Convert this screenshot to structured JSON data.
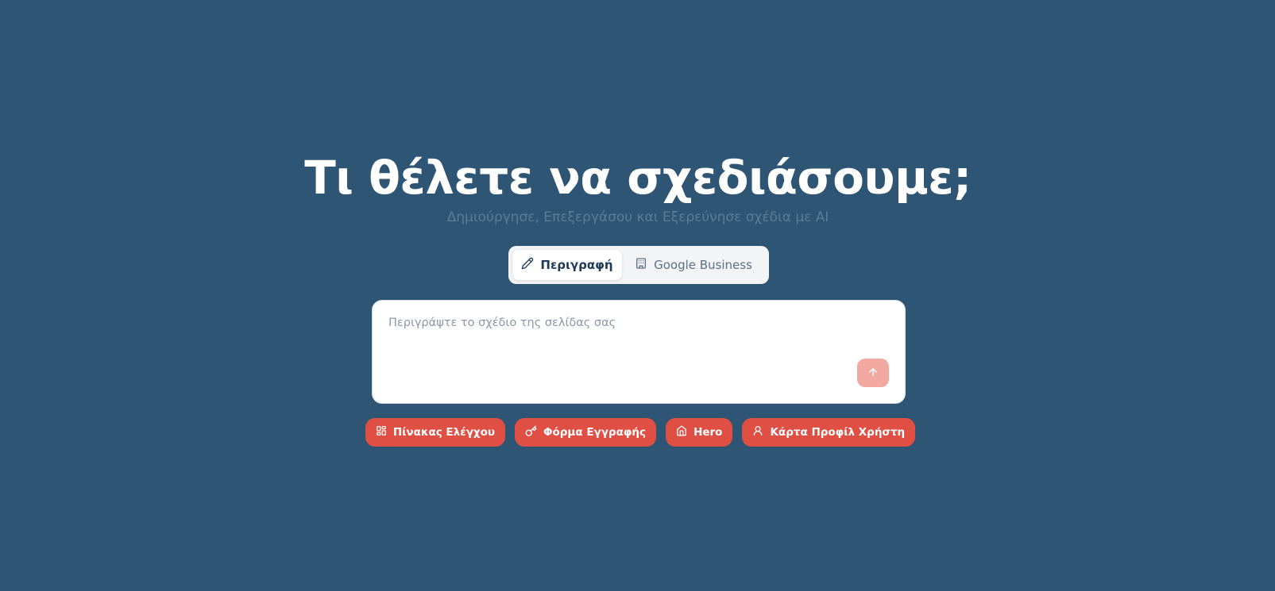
{
  "hero": {
    "title": "Τι θέλετε να σχεδιάσουμε;",
    "subtitle": "Δημιούργησε, Επεξεργάσου και Εξερεύνησε σχέδια με AI"
  },
  "tabs": [
    {
      "label": "Περιγραφή",
      "icon": "pencil-icon",
      "active": true
    },
    {
      "label": "Google Business",
      "icon": "building-icon",
      "active": false
    }
  ],
  "prompt": {
    "placeholder": "Περιγράψτε το σχέδιο της σελίδας σας",
    "value": "",
    "send_icon": "arrow-up-icon"
  },
  "suggestions": [
    {
      "label": "Πίνακας Ελέγχου",
      "icon": "dashboard-icon"
    },
    {
      "label": "Φόρμα Εγγραφής",
      "icon": "key-icon"
    },
    {
      "label": "Hero",
      "icon": "home-icon"
    },
    {
      "label": "Κάρτα Προφίλ Χρήστη",
      "icon": "user-icon"
    }
  ],
  "colors": {
    "background": "#2e5573",
    "accent": "#e04f44",
    "send_disabled": "#f1a9a2"
  }
}
